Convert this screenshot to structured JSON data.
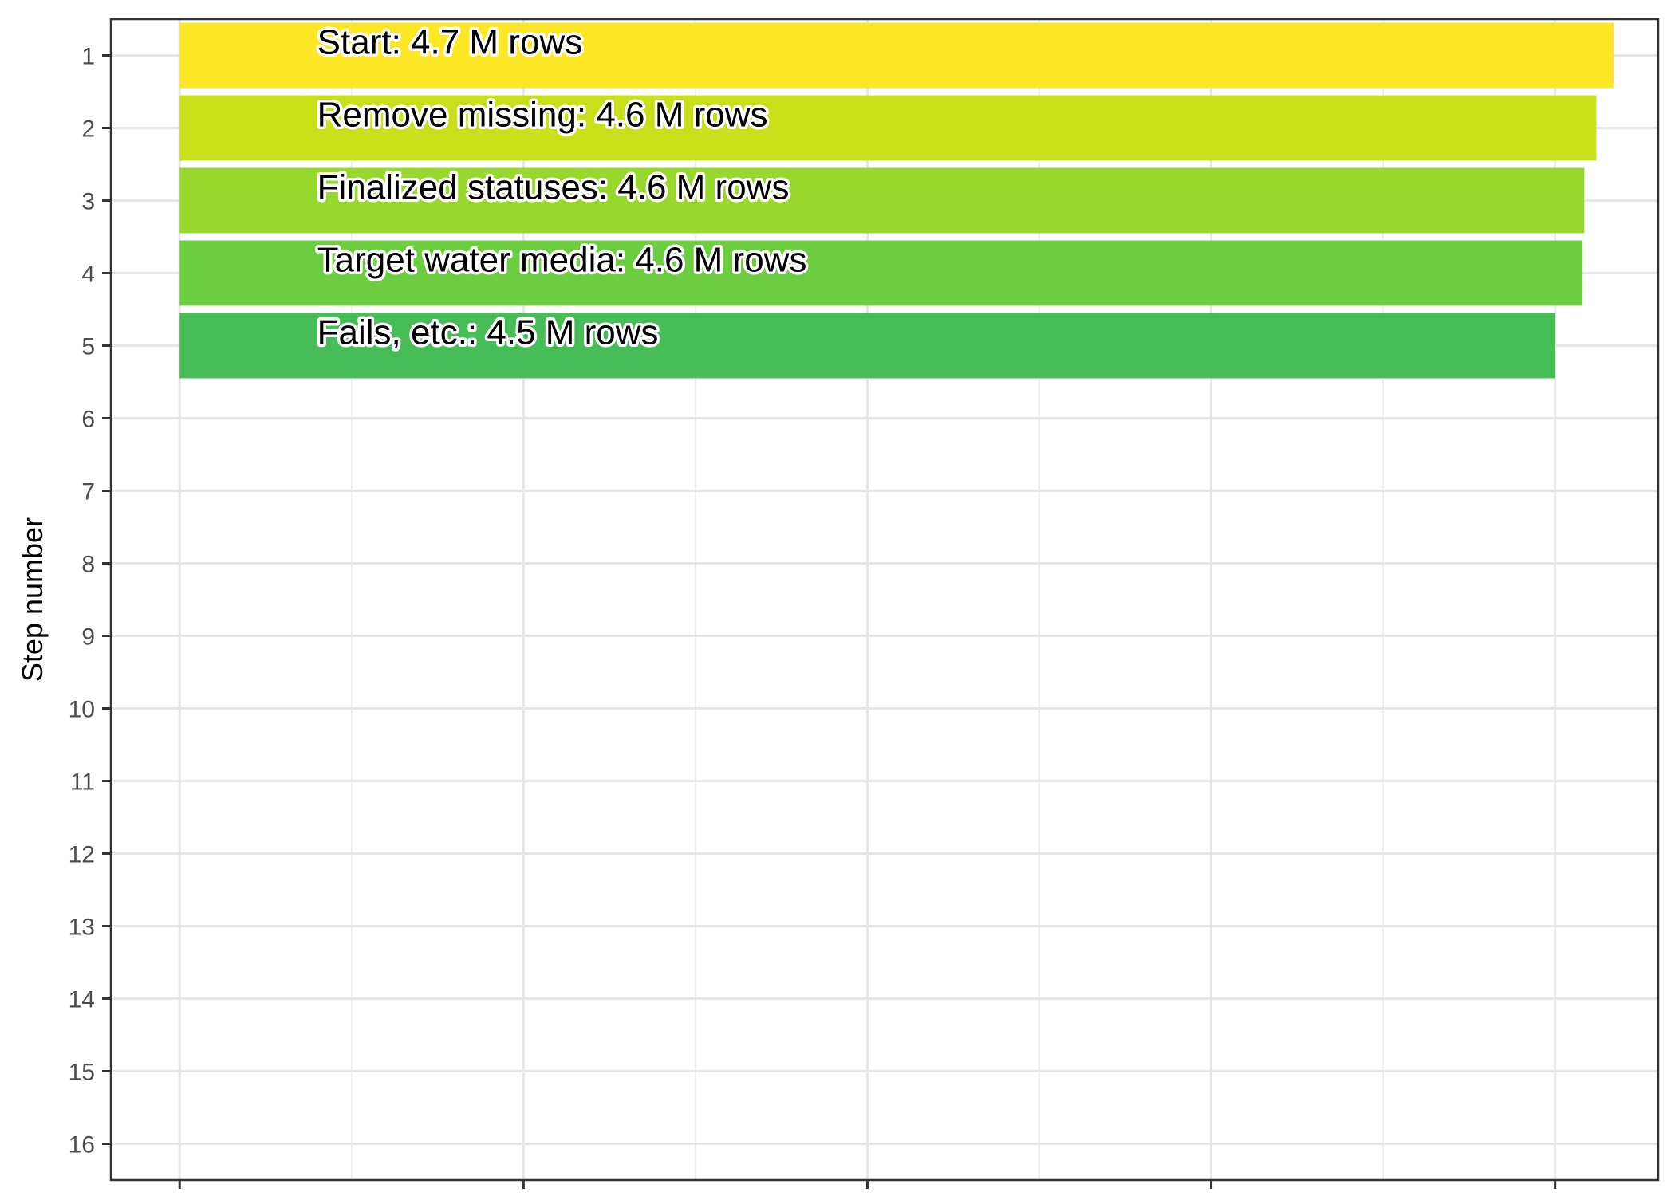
{
  "chart_data": {
    "type": "bar",
    "orientation": "horizontal",
    "ylabel": "Step number",
    "xlabel": "",
    "y_ticks": [
      "1",
      "2",
      "3",
      "4",
      "5",
      "6",
      "7",
      "8",
      "9",
      "10",
      "11",
      "12",
      "13",
      "14",
      "15",
      "16"
    ],
    "ylim": [
      0.5,
      16.5
    ],
    "x_ticks": [
      0,
      1,
      2,
      3,
      4
    ],
    "xlim": [
      -0.2,
      4.3
    ],
    "x_tick_labels_shown": false,
    "grid": true,
    "theme": "bw",
    "legend": "none",
    "series": [
      {
        "steps": [
          1,
          2,
          3,
          4,
          5
        ],
        "values": [
          4.7,
          4.6,
          4.6,
          4.6,
          4.5
        ],
        "plotted_lengths": [
          4.17,
          4.12,
          4.085,
          4.08,
          4.0
        ],
        "labels": [
          "Start:  4.7 M rows",
          "Remove missing:  4.6 M rows",
          "Finalized statuses:  4.6 M rows",
          "Target water media:  4.6 M rows",
          "Fails, etc.:  4.5 M rows"
        ],
        "colors": [
          "#FDE725",
          "#C8E01A",
          "#98D72C",
          "#6DCD41",
          "#47BD58"
        ],
        "unit": "M rows"
      }
    ]
  }
}
